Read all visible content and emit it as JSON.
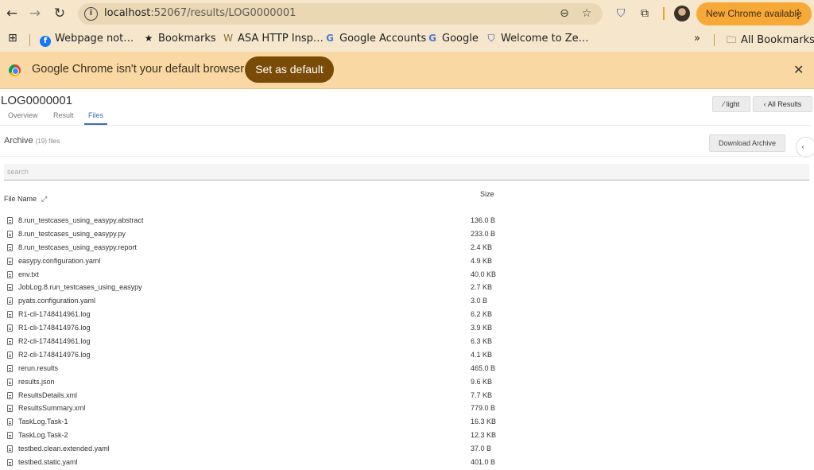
{
  "browser": {
    "url_host": "localhost",
    "url_path": ":52067/results/LOG0000001",
    "update_button": "New Chrome available",
    "bookmarks": [
      {
        "label": "Webpage not…",
        "icon": "facebook-icon"
      },
      {
        "label": "Bookmarks",
        "icon": "star-icon"
      },
      {
        "label": "ASA HTTP Insp…",
        "icon": "bookmark-icon"
      },
      {
        "label": "Google Accounts",
        "icon": "google-icon"
      },
      {
        "label": "Google",
        "icon": "google-icon"
      },
      {
        "label": "Welcome to Ze…",
        "icon": "shield-icon"
      }
    ],
    "all_bookmarks": "All Bookmarks",
    "overflow": "»"
  },
  "infobar": {
    "message": "Google Chrome isn't your default browser",
    "action": "Set as default"
  },
  "page": {
    "title": "LOG0000001",
    "tabs": [
      "Overview",
      "Result",
      "Files"
    ],
    "active_tab": "Files",
    "light_button": "light",
    "all_results_button": "All Results"
  },
  "archive": {
    "title": "Archive",
    "count_text": "(19) files",
    "download_button": "Download Archive",
    "search_placeholder": "search",
    "columns": {
      "name": "File Name",
      "size": "Size"
    },
    "files": [
      {
        "name": "8.run_testcases_using_easypy.abstract",
        "size": "136.0 B"
      },
      {
        "name": "8.run_testcases_using_easypy.py",
        "size": "233.0 B"
      },
      {
        "name": "8.run_testcases_using_easypy.report",
        "size": "2.4 KB"
      },
      {
        "name": "easypy.configuration.yaml",
        "size": "4.9 KB"
      },
      {
        "name": "env.txt",
        "size": "40.0 KB"
      },
      {
        "name": "JobLog.8.run_testcases_using_easypy",
        "size": "2.7 KB"
      },
      {
        "name": "pyats.configuration.yaml",
        "size": "3.0 B"
      },
      {
        "name": "R1-cli-1748414961.log",
        "size": "6.2 KB"
      },
      {
        "name": "R1-cli-1748414976.log",
        "size": "3.9 KB"
      },
      {
        "name": "R2-cli-1748414961.log",
        "size": "6.3 KB"
      },
      {
        "name": "R2-cli-1748414976.log",
        "size": "4.1 KB"
      },
      {
        "name": "rerun.results",
        "size": "465.0 B"
      },
      {
        "name": "results.json",
        "size": "9.6 KB"
      },
      {
        "name": "ResultsDetails.xml",
        "size": "7.7 KB"
      },
      {
        "name": "ResultsSummary.xml",
        "size": "779.0 B"
      },
      {
        "name": "TaskLog.Task-1",
        "size": "16.3 KB"
      },
      {
        "name": "TaskLog.Task-2",
        "size": "12.3 KB"
      },
      {
        "name": "testbed.clean.extended.yaml",
        "size": "37.0 B"
      },
      {
        "name": "testbed.static.yaml",
        "size": "401.0 B"
      }
    ]
  },
  "colors": {
    "chrome_bar": "#f6e7cc",
    "infobar": "#f9d8a4",
    "set_default_button": "#7a4a07",
    "update_button": "#f7a937",
    "active_tab": "#3b6fb6"
  }
}
